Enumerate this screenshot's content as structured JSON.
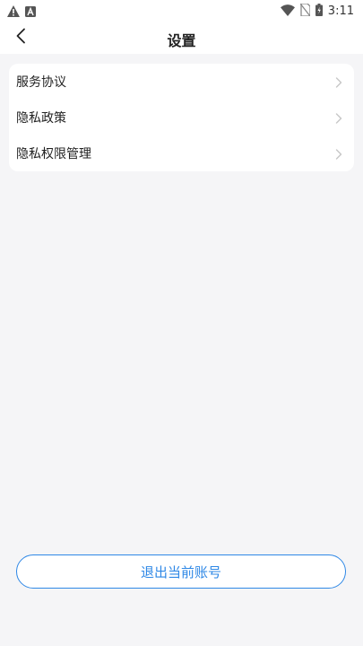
{
  "status_bar": {
    "time": "3:11",
    "icons": [
      "warning-icon",
      "app-a-icon",
      "wifi-icon",
      "no-sim-icon",
      "battery-icon"
    ]
  },
  "nav": {
    "title": "设置",
    "back_icon": "chevron-left-icon"
  },
  "settings_items": [
    {
      "label": "服务协议"
    },
    {
      "label": "隐私政策"
    },
    {
      "label": "隐私权限管理"
    }
  ],
  "logout": {
    "label": "退出当前账号"
  },
  "colors": {
    "accent": "#2f88e6",
    "background": "#f5f5f7",
    "card": "#ffffff",
    "chevron": "#c6c6c6"
  }
}
